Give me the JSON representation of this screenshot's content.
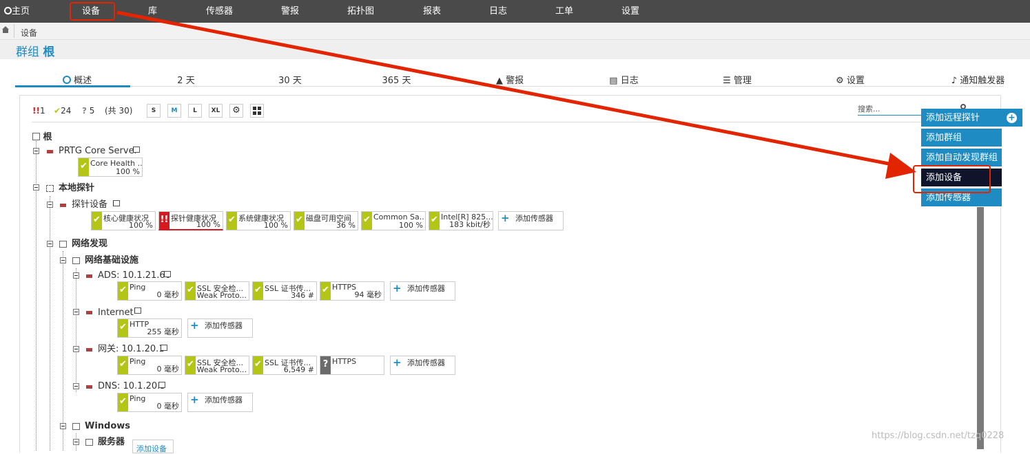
{
  "nav": {
    "home": "主页",
    "items": [
      "设备",
      "库",
      "传感器",
      "警报",
      "拓扑图",
      "报表",
      "日志",
      "工单",
      "设置"
    ]
  },
  "breadcrumb": "设备",
  "title": {
    "prefix": "群组",
    "name": "根"
  },
  "tabs": [
    "概述",
    "2 天",
    "30 天",
    "365 天",
    "警报",
    "日志",
    "管理",
    "设置",
    "通知触发器"
  ],
  "toolbar": {
    "down_count": "1",
    "up_count": "24",
    "unknown_count": "5",
    "total": "(共 30)",
    "sizes": [
      "S",
      "M",
      "L",
      "XL"
    ]
  },
  "search_placeholder": "搜索...",
  "tree": {
    "root": "根",
    "core_server": "PRTG Core Server",
    "local_probe": "本地探针",
    "probe_device": "探针设备",
    "net_discovery": "网络发现",
    "net_infra": "网络基础设施",
    "ads": "ADS: 10.1.21.60",
    "internet": "Internet",
    "gateway": "网关: 10.1.20.1",
    "dns": "DNS: 10.1.20.5",
    "windows": "Windows",
    "servers": "服务器",
    "add_device_partial": "添加设备"
  },
  "sensors": {
    "core": [
      {
        "name": "Core Health ...",
        "value": "100 %",
        "status": "ok"
      }
    ],
    "probe": [
      {
        "name": "核心健康状况",
        "value": "100 %",
        "status": "ok"
      },
      {
        "name": "探针健康状况",
        "value": "100 %",
        "status": "down"
      },
      {
        "name": "系统健康状况",
        "value": "100 %",
        "status": "ok"
      },
      {
        "name": "磁盘可用空间",
        "value": "36 %",
        "status": "ok"
      },
      {
        "name": "Common Sa...",
        "value": "100 %",
        "status": "ok"
      },
      {
        "name": "Intel[R] 825...",
        "value": "183 kbit/秒",
        "status": "ok"
      }
    ],
    "ads": [
      {
        "name": "Ping",
        "value": "0 毫秒",
        "status": "ok"
      },
      {
        "name": "SSL 安全检...",
        "value": "Weak Proto...",
        "status": "ok"
      },
      {
        "name": "SSL 证书传...",
        "value": "346 #",
        "status": "ok"
      },
      {
        "name": "HTTPS",
        "value": "94 毫秒",
        "status": "ok"
      }
    ],
    "internet": [
      {
        "name": "HTTP",
        "value": "255 毫秒",
        "status": "ok"
      }
    ],
    "gateway": [
      {
        "name": "Ping",
        "value": "0 毫秒",
        "status": "ok"
      },
      {
        "name": "SSL 安全检...",
        "value": "Weak Proto...",
        "status": "ok"
      },
      {
        "name": "SSL 证书传...",
        "value": "6,549 #",
        "status": "ok"
      },
      {
        "name": "HTTPS",
        "value": "",
        "status": "unknown"
      }
    ],
    "dns": [
      {
        "name": "Ping",
        "value": "0 毫秒",
        "status": "ok"
      }
    ]
  },
  "add_sensor_label": "添加传感器",
  "context_menu": [
    "添加远程探针",
    "添加群组",
    "添加自动发现群组",
    "添加设备",
    "添加传感器"
  ],
  "watermark": "https://blog.csdn.net/tzq0228"
}
